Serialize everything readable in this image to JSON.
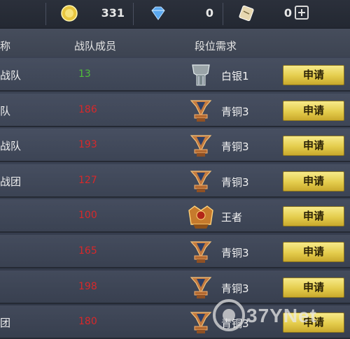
{
  "currency": {
    "gold": "331",
    "diamond": "0",
    "ticket": "0"
  },
  "headers": {
    "name": "称",
    "members": "战队成员",
    "rank_req": "段位需求"
  },
  "rows": [
    {
      "name": "战队",
      "members": "13",
      "members_color": "#4fbf3a",
      "rank": "白银1",
      "rank_icon": "silver-rank-icon",
      "apply": "申请"
    },
    {
      "name": "队",
      "members": "186",
      "members_color": "#d8282a",
      "rank": "青铜3",
      "rank_icon": "bronze-rank-icon",
      "apply": "申请"
    },
    {
      "name": "战队",
      "members": "193",
      "members_color": "#d8282a",
      "rank": "青铜3",
      "rank_icon": "bronze-rank-icon",
      "apply": "申请"
    },
    {
      "name": "战团",
      "members": "127",
      "members_color": "#d8282a",
      "rank": "青铜3",
      "rank_icon": "bronze-rank-icon",
      "apply": "申请"
    },
    {
      "name": "",
      "members": "100",
      "members_color": "#d8282a",
      "rank": "王者",
      "rank_icon": "king-rank-icon",
      "apply": "申请"
    },
    {
      "name": "",
      "members": "165",
      "members_color": "#d8282a",
      "rank": "青铜3",
      "rank_icon": "bronze-rank-icon",
      "apply": "申请"
    },
    {
      "name": "",
      "members": "198",
      "members_color": "#d8282a",
      "rank": "青铜3",
      "rank_icon": "bronze-rank-icon",
      "apply": "申请"
    },
    {
      "name": "团",
      "members": "180",
      "members_color": "#d8282a",
      "rank": "青铜3",
      "rank_icon": "bronze-rank-icon",
      "apply": "申请"
    }
  ],
  "watermark": "37YNet"
}
